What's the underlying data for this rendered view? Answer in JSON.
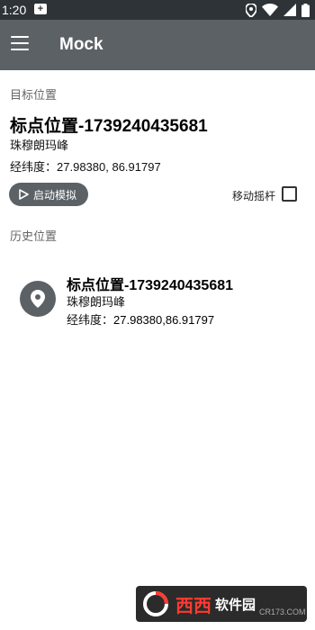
{
  "status_bar": {
    "time": "1:20",
    "notification": "+",
    "icons": [
      "location-icon",
      "wifi-icon",
      "signal-icon",
      "battery-icon"
    ]
  },
  "app_bar": {
    "title": "Mock",
    "menu_icon": "hamburger-menu-icon"
  },
  "target": {
    "section_label": "目标位置",
    "title": "标点位置-1739240435681",
    "subtitle": "珠穆朗玛峰",
    "coords_label": "经纬度：",
    "coords_value": "27.98380, 86.91797"
  },
  "controls": {
    "start_label": "启动模拟",
    "start_icon": "play-icon",
    "joystick_label": "移动摇杆",
    "joystick_checked": false
  },
  "history": {
    "section_label": "历史位置",
    "items": [
      {
        "icon": "location-pin-icon",
        "title": "标点位置-1739240435681",
        "subtitle": "珠穆朗玛峰",
        "coords_label": "经纬度：",
        "coords_value": "27.98380,86.91797"
      }
    ]
  },
  "watermark": {
    "brand": "西西",
    "text": "软件园",
    "sub": "CR173.COM"
  },
  "colors": {
    "app_bar": "#5c6166",
    "status_bar": "#2e3338",
    "button": "#5c6166"
  }
}
